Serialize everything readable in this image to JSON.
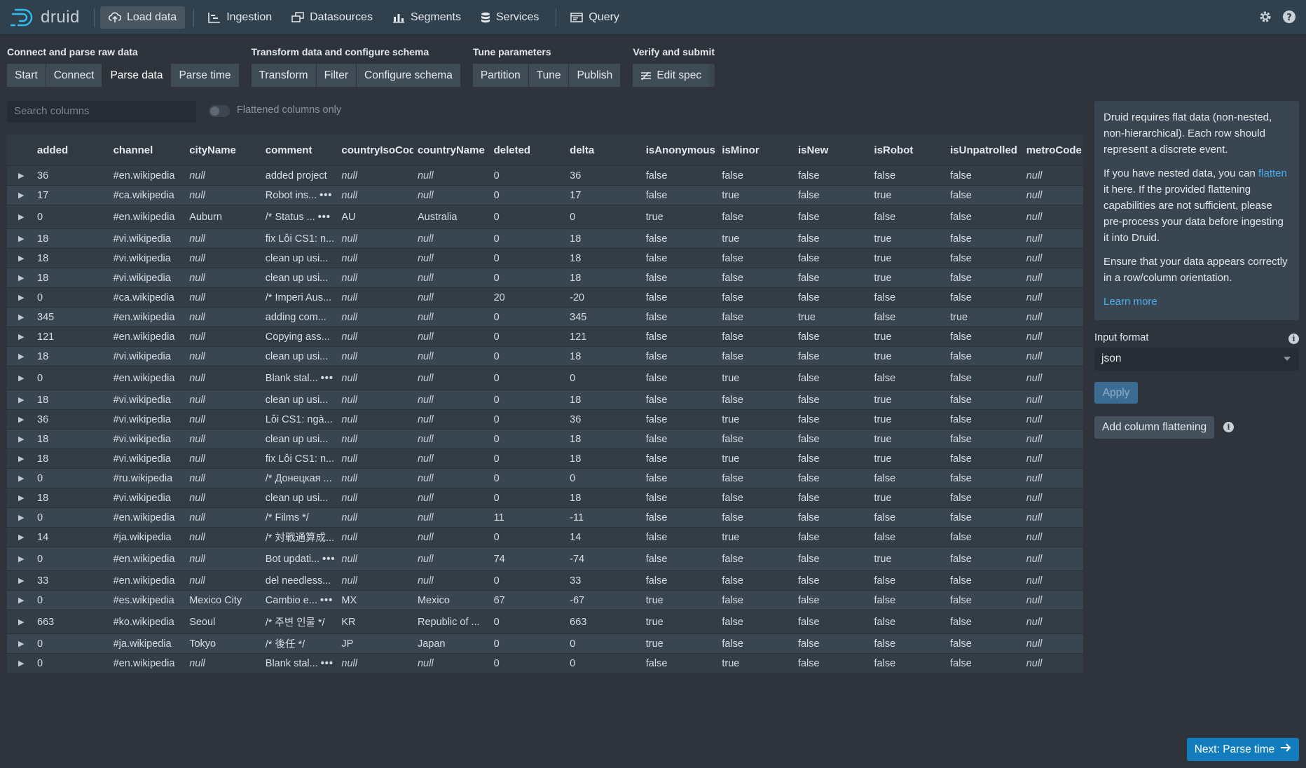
{
  "app": {
    "name": "druid"
  },
  "nav": [
    {
      "label": "Load data",
      "icon": "cloud-upload-icon",
      "active": true
    },
    {
      "label": "Ingestion",
      "icon": "gantt-chart-icon"
    },
    {
      "label": "Datasources",
      "icon": "multi-select-icon"
    },
    {
      "label": "Segments",
      "icon": "stacked-chart-icon"
    },
    {
      "label": "Services",
      "icon": "database-icon"
    },
    {
      "label": "Query",
      "icon": "application-icon"
    }
  ],
  "step_groups": [
    {
      "title": "Connect and parse raw data",
      "steps": [
        "Start",
        "Connect",
        "Parse data",
        "Parse time"
      ]
    },
    {
      "title": "Transform data and configure schema",
      "steps": [
        "Transform",
        "Filter",
        "Configure schema"
      ]
    },
    {
      "title": "Tune parameters",
      "steps": [
        "Partition",
        "Tune",
        "Publish"
      ]
    },
    {
      "title": "Verify and submit",
      "steps": [
        "Edit spec"
      ]
    }
  ],
  "active_step": "Parse data",
  "search": {
    "placeholder": "Search columns"
  },
  "flatten_toggle": {
    "label": "Flattened columns only",
    "on": false
  },
  "columns": [
    "added",
    "channel",
    "cityName",
    "comment",
    "countryIsoCode",
    "countryName",
    "deleted",
    "delta",
    "isAnonymous",
    "isMinor",
    "isNew",
    "isRobot",
    "isUnpatrolled",
    "metroCode"
  ],
  "rows": [
    [
      "36",
      "#en.wikipedia",
      "null",
      "added project",
      "null",
      "null",
      "0",
      "36",
      "false",
      "false",
      "false",
      "false",
      "false",
      "null"
    ],
    [
      "17",
      "#ca.wikipedia",
      "null",
      "Robot ins...",
      "null",
      "null",
      "0",
      "17",
      "false",
      "true",
      "false",
      "true",
      "false",
      "null"
    ],
    [
      "0",
      "#en.wikipedia",
      "Auburn",
      "/* Status ...",
      "AU",
      "Australia",
      "0",
      "0",
      "true",
      "false",
      "false",
      "false",
      "false",
      "null"
    ],
    [
      "18",
      "#vi.wikipedia",
      "null",
      "fix Lỗi CS1: n...",
      "null",
      "null",
      "0",
      "18",
      "false",
      "true",
      "false",
      "true",
      "false",
      "null"
    ],
    [
      "18",
      "#vi.wikipedia",
      "null",
      "clean up usi...",
      "null",
      "null",
      "0",
      "18",
      "false",
      "false",
      "false",
      "true",
      "false",
      "null"
    ],
    [
      "18",
      "#vi.wikipedia",
      "null",
      "clean up usi...",
      "null",
      "null",
      "0",
      "18",
      "false",
      "false",
      "false",
      "true",
      "false",
      "null"
    ],
    [
      "0",
      "#ca.wikipedia",
      "null",
      "/* Imperi Aus...",
      "null",
      "null",
      "20",
      "-20",
      "false",
      "false",
      "false",
      "false",
      "false",
      "null"
    ],
    [
      "345",
      "#en.wikipedia",
      "null",
      "adding com...",
      "null",
      "null",
      "0",
      "345",
      "false",
      "false",
      "true",
      "false",
      "true",
      "null"
    ],
    [
      "121",
      "#en.wikipedia",
      "null",
      "Copying ass...",
      "null",
      "null",
      "0",
      "121",
      "false",
      "false",
      "false",
      "true",
      "false",
      "null"
    ],
    [
      "18",
      "#vi.wikipedia",
      "null",
      "clean up usi...",
      "null",
      "null",
      "0",
      "18",
      "false",
      "false",
      "false",
      "true",
      "false",
      "null"
    ],
    [
      "0",
      "#en.wikipedia",
      "null",
      "Blank stal...",
      "null",
      "null",
      "0",
      "0",
      "false",
      "true",
      "false",
      "false",
      "false",
      "null"
    ],
    [
      "18",
      "#vi.wikipedia",
      "null",
      "clean up usi...",
      "null",
      "null",
      "0",
      "18",
      "false",
      "false",
      "false",
      "true",
      "false",
      "null"
    ],
    [
      "36",
      "#vi.wikipedia",
      "null",
      "Lỗi CS1: ngà...",
      "null",
      "null",
      "0",
      "36",
      "false",
      "true",
      "false",
      "true",
      "false",
      "null"
    ],
    [
      "18",
      "#vi.wikipedia",
      "null",
      "clean up usi...",
      "null",
      "null",
      "0",
      "18",
      "false",
      "false",
      "false",
      "true",
      "false",
      "null"
    ],
    [
      "18",
      "#vi.wikipedia",
      "null",
      "fix Lỗi CS1: n...",
      "null",
      "null",
      "0",
      "18",
      "false",
      "true",
      "false",
      "true",
      "false",
      "null"
    ],
    [
      "0",
      "#ru.wikipedia",
      "null",
      "/* Донецкая ...",
      "null",
      "null",
      "0",
      "0",
      "false",
      "false",
      "false",
      "false",
      "false",
      "null"
    ],
    [
      "18",
      "#vi.wikipedia",
      "null",
      "clean up usi...",
      "null",
      "null",
      "0",
      "18",
      "false",
      "false",
      "false",
      "true",
      "false",
      "null"
    ],
    [
      "0",
      "#en.wikipedia",
      "null",
      "/* Films */",
      "null",
      "null",
      "11",
      "-11",
      "false",
      "false",
      "false",
      "false",
      "false",
      "null"
    ],
    [
      "14",
      "#ja.wikipedia",
      "null",
      "/* 対戦通算成...",
      "null",
      "null",
      "0",
      "14",
      "false",
      "true",
      "false",
      "false",
      "false",
      "null"
    ],
    [
      "0",
      "#en.wikipedia",
      "null",
      "Bot updati...",
      "null",
      "null",
      "74",
      "-74",
      "false",
      "false",
      "false",
      "true",
      "false",
      "null"
    ],
    [
      "33",
      "#en.wikipedia",
      "null",
      "del needless...",
      "null",
      "null",
      "0",
      "33",
      "false",
      "false",
      "false",
      "false",
      "false",
      "null"
    ],
    [
      "0",
      "#es.wikipedia",
      "Mexico City",
      "Cambio e...",
      "MX",
      "Mexico",
      "67",
      "-67",
      "true",
      "false",
      "false",
      "false",
      "false",
      "null"
    ],
    [
      "663",
      "#ko.wikipedia",
      "Seoul",
      "/* 주변 인물 */",
      "KR",
      "Republic of ...",
      "0",
      "663",
      "true",
      "false",
      "false",
      "false",
      "false",
      "null"
    ],
    [
      "0",
      "#ja.wikipedia",
      "Tokyo",
      "/* 後任 */",
      "JP",
      "Japan",
      "0",
      "0",
      "true",
      "false",
      "false",
      "false",
      "false",
      "null"
    ],
    [
      "0",
      "#en.wikipedia",
      "null",
      "Blank stal...",
      "null",
      "null",
      "0",
      "0",
      "false",
      "true",
      "false",
      "false",
      "false",
      "null"
    ]
  ],
  "expanded_comment_rows": [
    1,
    2,
    10,
    19,
    21,
    24
  ],
  "more_marker": "•••",
  "side_panel": {
    "p1": "Druid requires flat data (non-nested, non-hierarchical). Each row should represent a discrete event.",
    "p2_before": "If you have nested data, you can ",
    "p2_link": "flatten",
    "p2_after": " it here. If the provided flattening capabilities are not sufficient, please pre-process your data before ingesting it into Druid.",
    "p3": "Ensure that your data appears correctly in a row/column orientation.",
    "learn_more": "Learn more"
  },
  "input_format": {
    "label": "Input format",
    "value": "json"
  },
  "buttons": {
    "apply": "Apply",
    "add_flattening": "Add column flattening",
    "next": "Next: Parse time"
  },
  "colors": {
    "accent": "#137cbd",
    "link": "#48aff0",
    "bg": "#2f343c"
  }
}
